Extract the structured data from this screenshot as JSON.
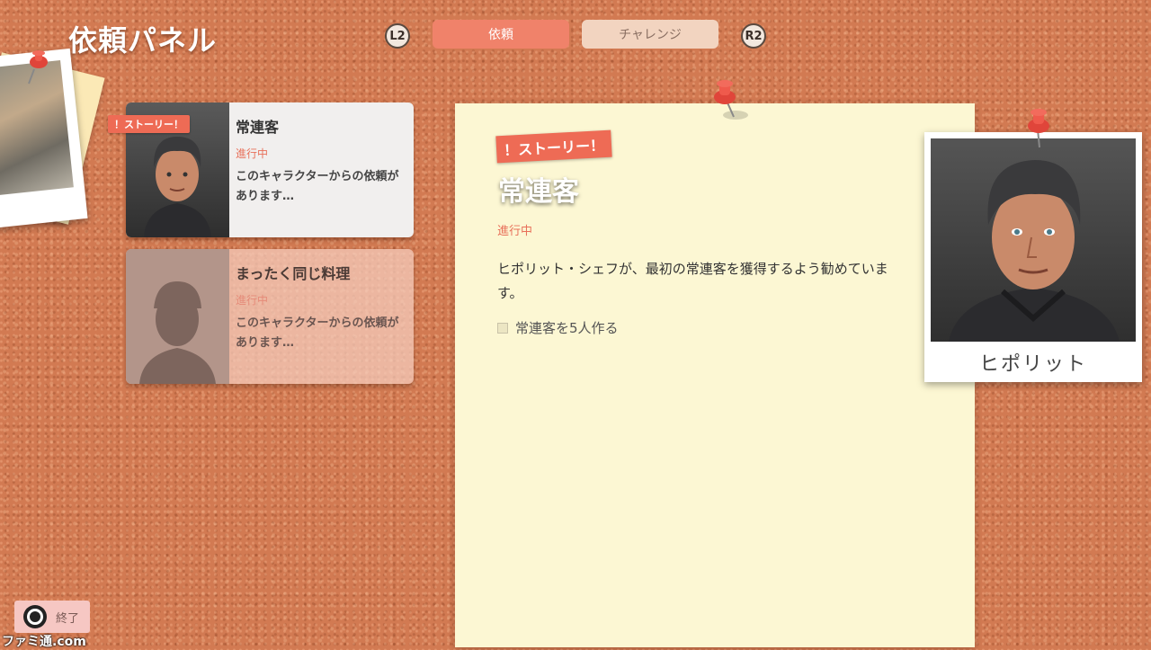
{
  "header": {
    "title": "依頼パネル",
    "left_shoulder": "L2",
    "right_shoulder": "R2",
    "tabs": [
      {
        "label": "依頼",
        "active": true
      },
      {
        "label": "チャレンジ",
        "active": false
      }
    ]
  },
  "requests": [
    {
      "badge": "！ストーリー！",
      "title": "常連客",
      "status": "進行中",
      "description": "このキャラクターからの依頼があります…"
    },
    {
      "title": "まったく同じ料理",
      "status": "進行中",
      "description": "このキャラクターからの依頼があります…"
    }
  ],
  "detail": {
    "badge": "！ストーリー！",
    "title": "常連客",
    "status": "進行中",
    "description": "ヒポリット・シェフが、最初の常連客を獲得するよう勧めています。",
    "objective": "常連客を5人作る"
  },
  "character": {
    "name": "ヒポリット"
  },
  "footer": {
    "end_label": "終了",
    "watermark": "ファミ通.com"
  },
  "colors": {
    "accent": "#ee6b55",
    "status": "#e8705a",
    "tab_active": "#f0826a",
    "cork": "#d27a52",
    "note": "#fcf7d3"
  }
}
